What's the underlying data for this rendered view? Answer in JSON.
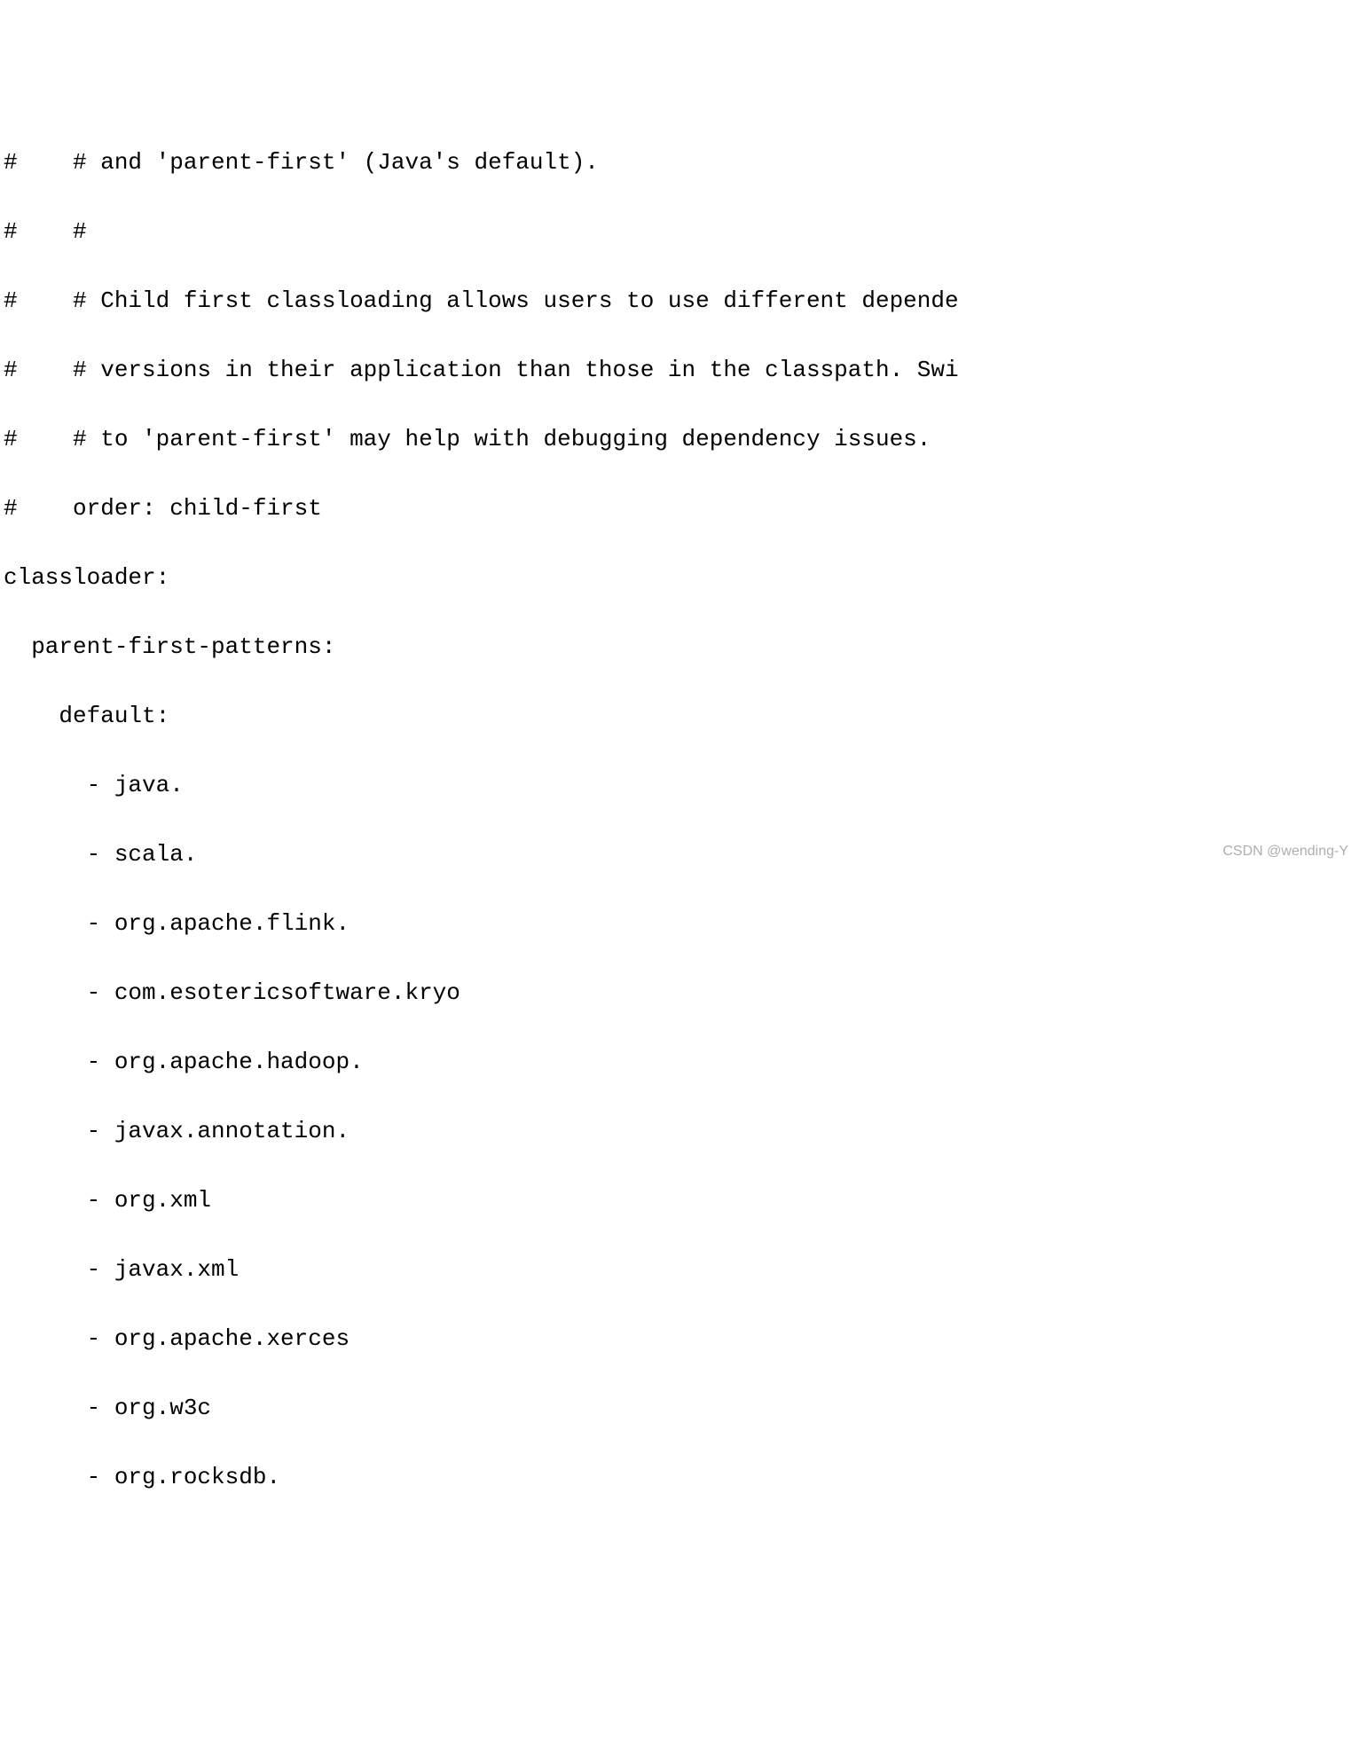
{
  "lines": {
    "l1": "#    # and 'parent-first' (Java's default).",
    "l2": "#    #",
    "l3": "#    # Child first classloading allows users to use different depende",
    "l4": "#    # versions in their application than those in the classpath. Swi",
    "l5": "#    # to 'parent-first' may help with debugging dependency issues.",
    "l6": "#    order: child-first",
    "l7": "classloader:",
    "l8": "  parent-first-patterns:",
    "l9": "    default:",
    "l10": "      - java.",
    "l11": "      - scala.",
    "l12": "      - org.apache.flink.",
    "l13": "      - com.esotericsoftware.kryo",
    "l14": "      - org.apache.hadoop.",
    "l15": "      - javax.annotation.",
    "l16": "      - org.xml",
    "l17": "      - javax.xml",
    "l18": "      - org.apache.xerces",
    "l19": "      - org.w3c",
    "l20": "      - org.rocksdb."
  },
  "watermark": "CSDN @wending-Y"
}
